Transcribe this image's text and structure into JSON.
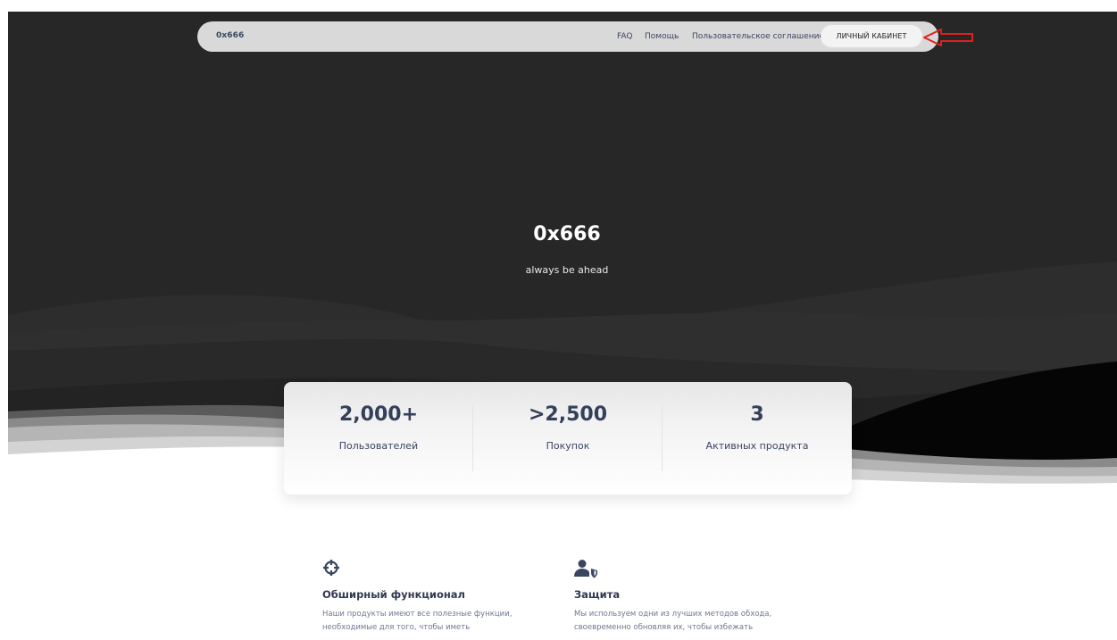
{
  "header": {
    "brand": "0x666",
    "nav": [
      {
        "label": "FAQ"
      },
      {
        "label": "Помощь"
      },
      {
        "label": "Пользовательское соглашение"
      }
    ],
    "cabinet_button": "ЛИЧНЫЙ КАБИНЕТ"
  },
  "hero": {
    "title": "0x666",
    "subtitle": "always be ahead"
  },
  "stats": [
    {
      "value": "2,000+",
      "label": "Пользователей"
    },
    {
      "value": ">2,500",
      "label": "Покупок"
    },
    {
      "value": "3",
      "label": "Активных продукта"
    }
  ],
  "features": [
    {
      "icon": "crosshair-icon",
      "title": "Обширный функционал",
      "description": "Наши продукты имеют все полезные функции, необходимые для того, чтобы иметь"
    },
    {
      "icon": "user-shield-icon",
      "title": "Защита",
      "description": "Мы используем одни из лучших методов обхода, своевременно обновляя их, чтобы избежать"
    }
  ],
  "annotation": {
    "arrow_color": "#e0201c"
  }
}
